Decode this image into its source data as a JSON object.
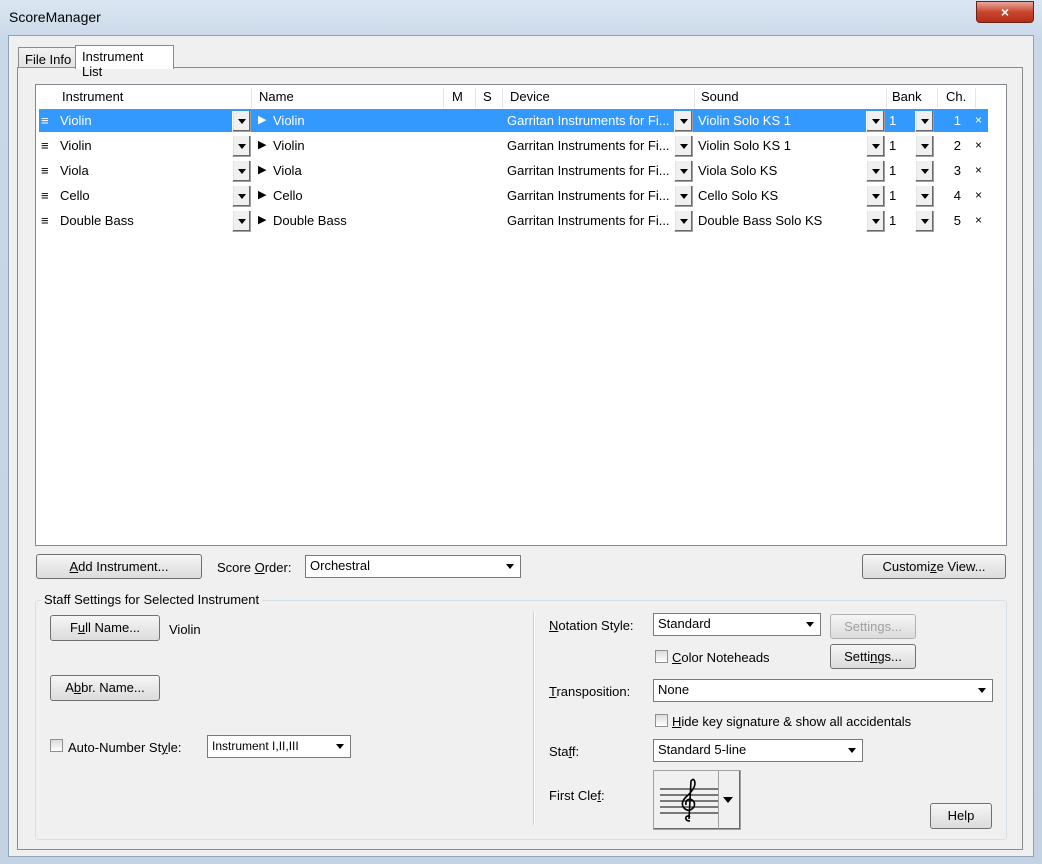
{
  "window": {
    "title": "ScoreManager",
    "close_glyph": "×"
  },
  "tabs": [
    {
      "label": "File Info",
      "active": false
    },
    {
      "label": "Instrument List",
      "active": true
    }
  ],
  "columns": [
    "Instrument",
    "Name",
    "M",
    "S",
    "Device",
    "Sound",
    "Bank",
    "Ch."
  ],
  "rows": [
    {
      "instrument": "Violin",
      "name": "Violin",
      "device": "Garritan Instruments for Fi...",
      "sound": "Violin Solo KS 1",
      "bank": "1",
      "channel": "1",
      "selected": true
    },
    {
      "instrument": "Violin",
      "name": "Violin",
      "device": "Garritan Instruments for Fi...",
      "sound": "Violin Solo KS 1",
      "bank": "1",
      "channel": "2",
      "selected": false
    },
    {
      "instrument": "Viola",
      "name": "Viola",
      "device": "Garritan Instruments for Fi...",
      "sound": "Viola Solo KS",
      "bank": "1",
      "channel": "3",
      "selected": false
    },
    {
      "instrument": "Cello",
      "name": "Cello",
      "device": "Garritan Instruments for Fi...",
      "sound": "Cello Solo KS",
      "bank": "1",
      "channel": "4",
      "selected": false
    },
    {
      "instrument": "Double Bass",
      "name": "Double Bass",
      "device": "Garritan Instruments for Fi...",
      "sound": "Double Bass Solo KS",
      "bank": "1",
      "channel": "5",
      "selected": false
    }
  ],
  "row_glyphs": {
    "handle": "≡",
    "expand": "▶",
    "delete": "×"
  },
  "toolbar": {
    "add_instrument_pre": "",
    "add_instrument_key": "A",
    "add_instrument_post": "dd Instrument...",
    "score_order_pre": "Score ",
    "score_order_key": "O",
    "score_order_post": "rder:",
    "score_order_value": "Orchestral",
    "customize_pre": "Customi",
    "customize_key": "z",
    "customize_post": "e View..."
  },
  "staff_settings": {
    "group_title": "Staff Settings for Selected Instrument",
    "full_name_pre": "F",
    "full_name_key": "u",
    "full_name_post": "ll Name...",
    "full_name_value": "Violin",
    "abbr_pre": "A",
    "abbr_key": "b",
    "abbr_post": "br. Name...",
    "auto_number_pre": "Auto-Number St",
    "auto_number_key": "y",
    "auto_number_post": "le:",
    "auto_number_value": "Instrument I,II,III",
    "notation_pre": "",
    "notation_key": "N",
    "notation_post": "otation Style:",
    "notation_value": "Standard",
    "settings_disabled": "Settings...",
    "color_noteheads_pre": "",
    "color_noteheads_key": "C",
    "color_noteheads_post": "olor Noteheads",
    "settings_pre": "Setti",
    "settings_key": "n",
    "settings_post": "gs...",
    "transposition_pre": "",
    "transposition_key": "T",
    "transposition_post": "ransposition:",
    "transposition_value": "None",
    "hide_key_pre": "",
    "hide_key_key": "H",
    "hide_key_post": "ide key signature & show all accidentals",
    "staff_pre": "Sta",
    "staff_key": "f",
    "staff_post": "f:",
    "staff_value": "Standard 5-line",
    "first_clef_pre": "First Cle",
    "first_clef_key": "f",
    "first_clef_post": ":",
    "clef_glyph": "𝄞",
    "help": "Help"
  }
}
